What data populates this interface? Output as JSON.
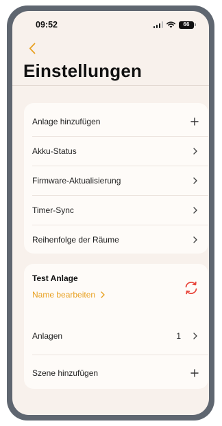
{
  "status_bar": {
    "time": "09:52",
    "battery": "66"
  },
  "header": {
    "title": "Einstellungen"
  },
  "settings_list": [
    {
      "label": "Anlage hinzufügen",
      "action": "plus"
    },
    {
      "label": "Akku-Status",
      "action": "chevron"
    },
    {
      "label": "Firmware-Aktualisierung",
      "action": "chevron"
    },
    {
      "label": "Timer-Sync",
      "action": "chevron"
    },
    {
      "label": "Reihenfolge der Räume",
      "action": "chevron"
    }
  ],
  "installation": {
    "name": "Test Anlage",
    "edit_label": "Name bearbeiten",
    "systems_label": "Anlagen",
    "systems_count": "1",
    "add_scene_label": "Szene hinzufügen"
  },
  "colors": {
    "accent_orange": "#e8a020",
    "sync_red": "#e8463c",
    "background": "#f8f1ec",
    "card": "#fefbf8",
    "frame": "#5f6670"
  }
}
